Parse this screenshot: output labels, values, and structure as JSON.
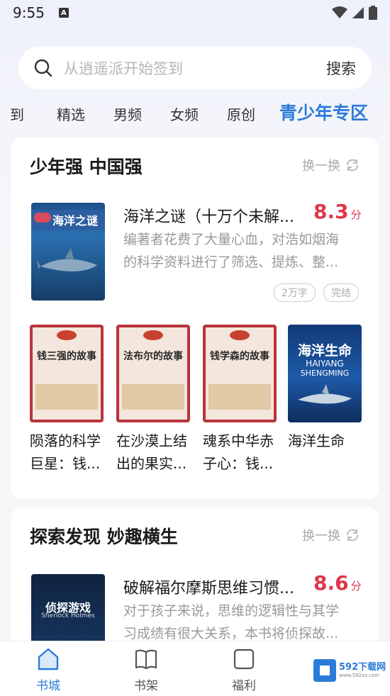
{
  "status": {
    "time": "9:55",
    "badge": "A"
  },
  "search": {
    "placeholder": "从逍遥派开始签到",
    "button": "搜索"
  },
  "tabs": [
    {
      "label": "到"
    },
    {
      "label": "精选"
    },
    {
      "label": "男频"
    },
    {
      "label": "女频"
    },
    {
      "label": "原创"
    },
    {
      "label": "青少年专区"
    }
  ],
  "section1": {
    "title": "少年强 中国强",
    "refresh": "换一换",
    "featured": {
      "title": "海洋之谜（十万个未解...",
      "score": "8.3",
      "score_unit": "分",
      "desc_line1": "编著者花费了大量心血，对浩如烟海",
      "desc_line2": "的科学资料进行了筛选、提炼、整...",
      "tags": [
        "2万字",
        "完结"
      ],
      "cover_text": "海洋之谜"
    },
    "books": [
      {
        "title_line1": "陨落的科学",
        "title_line2": "巨星：钱...",
        "cover_text": "钱三强的故事"
      },
      {
        "title_line1": "在沙漠上结",
        "title_line2": "出的果实...",
        "cover_text": "法布尔的故事"
      },
      {
        "title_line1": "魂系中华赤",
        "title_line2": "子心：钱...",
        "cover_text": "钱学森的故事"
      },
      {
        "title_line1": "海洋生命",
        "title_line2": "",
        "cover_text": "海洋生命",
        "cover_sub1": "HAIYANG",
        "cover_sub2": "SHENGMING"
      }
    ]
  },
  "section2": {
    "title": "探索发现 妙趣横生",
    "refresh": "换一换",
    "featured": {
      "title": "破解福尔摩斯思维习惯...",
      "score": "8.6",
      "score_unit": "分",
      "desc_line1": "对于孩子来说，思维的逻辑性与其学",
      "desc_line2": "习成绩有很大关系，本书将侦探故...",
      "cover_text": "侦探游戏",
      "cover_sub": "Sherlock Holmes"
    }
  },
  "nav": [
    {
      "label": "书城",
      "active": true
    },
    {
      "label": "书架",
      "active": false
    },
    {
      "label": "福利",
      "active": false
    }
  ],
  "watermark": {
    "text": "592下载网",
    "sub": "www.592xz.com"
  },
  "colors": {
    "accent": "#2b7bd8",
    "score": "#e0364a"
  }
}
